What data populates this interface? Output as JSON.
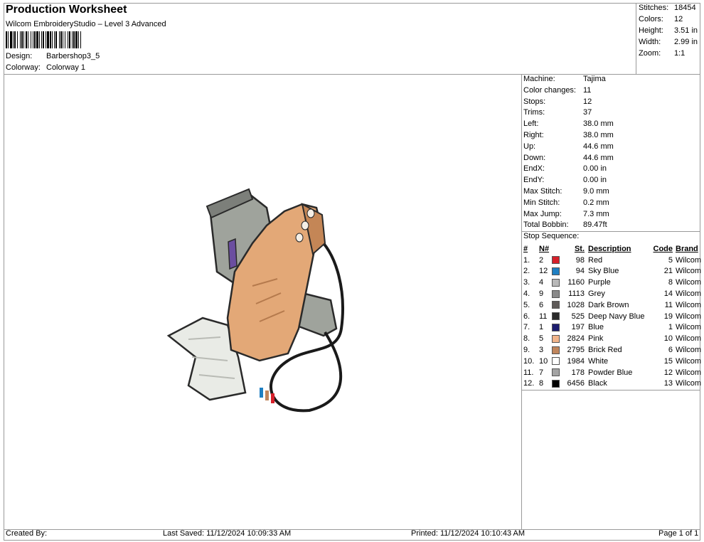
{
  "header": {
    "title": "Production Worksheet",
    "subtitle": "Wilcom EmbroideryStudio – Level 3 Advanced",
    "design_label": "Design:",
    "design_value": "Barbershop3_5",
    "colorway_label": "Colorway:",
    "colorway_value": "Colorway 1"
  },
  "stats": [
    {
      "label": "Stitches:",
      "value": "18454"
    },
    {
      "label": "Colors:",
      "value": "12"
    },
    {
      "label": "Height:",
      "value": "3.51 in"
    },
    {
      "label": "Width:",
      "value": "2.99 in"
    },
    {
      "label": "Zoom:",
      "value": "1:1"
    }
  ],
  "machine_info": [
    {
      "label": "Machine:",
      "value": "Tajima"
    },
    {
      "label": "Color changes:",
      "value": "11"
    },
    {
      "label": "Stops:",
      "value": "12"
    },
    {
      "label": "Trims:",
      "value": "37"
    },
    {
      "label": "Left:",
      "value": "38.0 mm"
    },
    {
      "label": "Right:",
      "value": "38.0 mm"
    },
    {
      "label": "Up:",
      "value": "44.6 mm"
    },
    {
      "label": "Down:",
      "value": "44.6 mm"
    },
    {
      "label": "EndX:",
      "value": "0.00 in"
    },
    {
      "label": "EndY:",
      "value": "0.00 in"
    },
    {
      "label": "Max Stitch:",
      "value": "9.0 mm"
    },
    {
      "label": "Min Stitch:",
      "value": "0.2 mm"
    },
    {
      "label": "Max Jump:",
      "value": "7.3 mm"
    },
    {
      "label": "Total Bobbin:",
      "value": "89.47ft"
    }
  ],
  "stop_sequence": {
    "title": "Stop Sequence:",
    "headers": {
      "num": "#",
      "n": "N#",
      "st": "St.",
      "desc": "Description",
      "code": "Code",
      "brand": "Brand"
    },
    "rows": [
      {
        "num": "1.",
        "n": "2",
        "color": "#d6202a",
        "st": "98",
        "desc": "Red",
        "code": "5",
        "brand": "Wilcom"
      },
      {
        "num": "2.",
        "n": "12",
        "color": "#1f7fc2",
        "st": "94",
        "desc": "Sky Blue",
        "code": "21",
        "brand": "Wilcom"
      },
      {
        "num": "3.",
        "n": "4",
        "color": "#b8b8b8",
        "st": "1160",
        "desc": "Purple",
        "code": "8",
        "brand": "Wilcom"
      },
      {
        "num": "4.",
        "n": "9",
        "color": "#8a8a8a",
        "st": "1113",
        "desc": "Grey",
        "code": "14",
        "brand": "Wilcom"
      },
      {
        "num": "5.",
        "n": "6",
        "color": "#5e5a58",
        "st": "1028",
        "desc": "Dark Brown",
        "code": "11",
        "brand": "Wilcom"
      },
      {
        "num": "6.",
        "n": "11",
        "color": "#2a2a2a",
        "st": "525",
        "desc": "Deep Navy Blue",
        "code": "19",
        "brand": "Wilcom"
      },
      {
        "num": "7.",
        "n": "1",
        "color": "#1c1c6e",
        "st": "197",
        "desc": "Blue",
        "code": "1",
        "brand": "Wilcom"
      },
      {
        "num": "8.",
        "n": "5",
        "color": "#f1b48a",
        "st": "2824",
        "desc": "Pink",
        "code": "10",
        "brand": "Wilcom"
      },
      {
        "num": "9.",
        "n": "3",
        "color": "#c0855c",
        "st": "2795",
        "desc": "Brick Red",
        "code": "6",
        "brand": "Wilcom"
      },
      {
        "num": "10.",
        "n": "10",
        "color": "#ffffff",
        "st": "1984",
        "desc": "White",
        "code": "15",
        "brand": "Wilcom"
      },
      {
        "num": "11.",
        "n": "7",
        "color": "#a3a3a3",
        "st": "178",
        "desc": "Powder Blue",
        "code": "12",
        "brand": "Wilcom"
      },
      {
        "num": "12.",
        "n": "8",
        "color": "#000000",
        "st": "6456",
        "desc": "Black",
        "code": "13",
        "brand": "Wilcom"
      }
    ]
  },
  "footer": {
    "created_by": "Created By:",
    "last_saved": "Last Saved: 11/12/2024 10:09:33 AM",
    "printed": "Printed: 11/12/2024 10:10:43 AM",
    "page": "Page 1 of 1"
  },
  "colors": {
    "skin_light": "#e3a877",
    "skin_dark": "#c48656",
    "sleeve": "#e9ebe6",
    "clipper_grey": "#9a9d98",
    "purple": "#6b4ea0",
    "black": "#1a1a1a"
  }
}
